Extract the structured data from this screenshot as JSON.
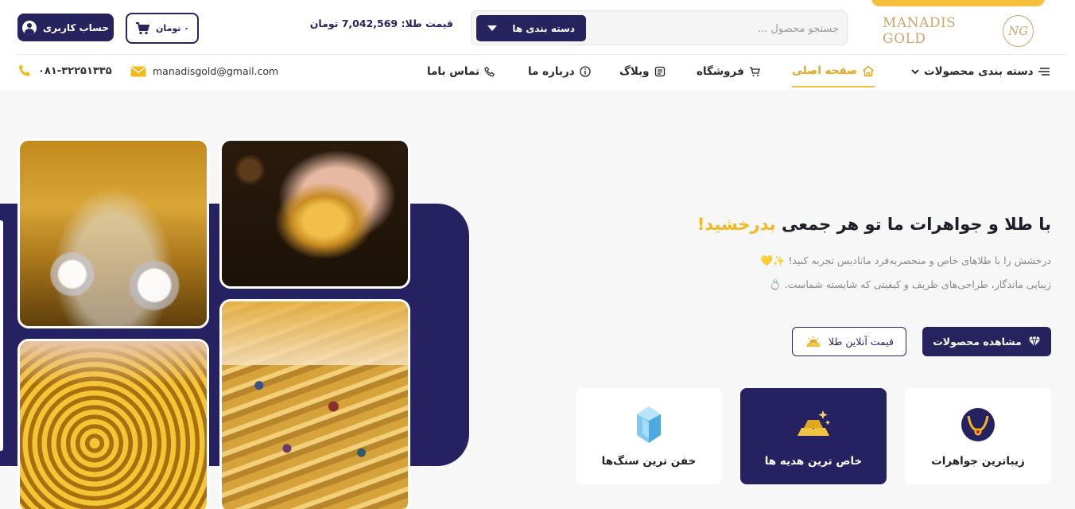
{
  "header": {
    "logo_text": "MANADIS GOLD",
    "logo_mark": "NG",
    "search_placeholder": "جستجو محصول ...",
    "category_button": "دسته بندی ها",
    "gold_price": "قیمت طلا: 7,042,569 تومان",
    "cart_label": "۰ تومان",
    "account_label": "حساب کاربری"
  },
  "nav": {
    "categories": "دسته بندی محصولات",
    "home": "صفحه اصلی",
    "shop": "فروشگاه",
    "blog": "وبلاگ",
    "about": "درباره ما",
    "contact": "تماس باما"
  },
  "contact": {
    "email": "manadisgold@gmail.com",
    "phone": "۰۸۱-۳۲۲۵۱۳۳۵"
  },
  "hero": {
    "title_main": "با طلا و جواهرات ما تو هر جمعی ",
    "title_accent": "بدرخشید!",
    "line1": "درخشش را با طلاهای خاص و منحصربه‌فرد مانادیس تجربه کنید! ✨💛",
    "line2": "زیبایی ماندگار، طراحی‌های ظریف و کیفیتی که شایسته شماست. 💍",
    "btn_products": "مشاهده محصولات",
    "btn_price": "قیمت آنلاین طلا"
  },
  "cards": {
    "jewelry": "زیباترین جواهرات",
    "gifts": "خاص ترین هدیه ها",
    "stones": "خفن ترین سنگ‌ها"
  },
  "colors": {
    "primary": "#27235f",
    "accent": "#f2b81c"
  }
}
